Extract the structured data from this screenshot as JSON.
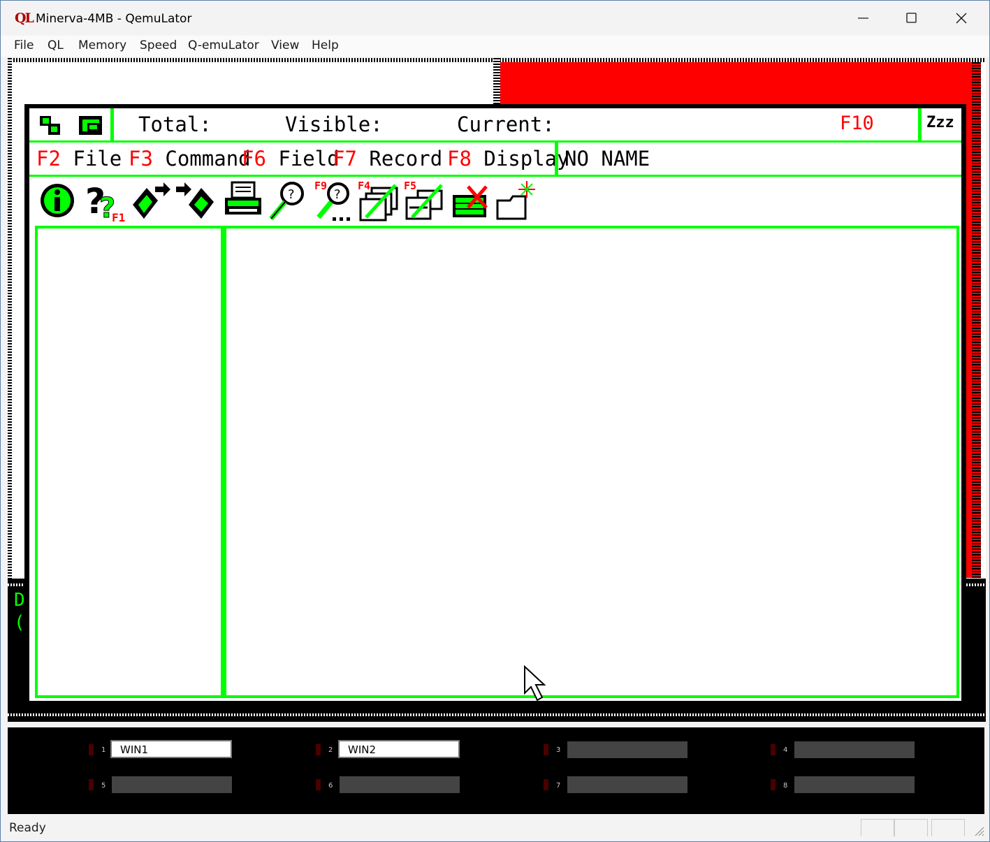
{
  "window": {
    "app_icon": "QL",
    "title": "Minerva-4MB - QemuLator",
    "controls": [
      "minimize-icon",
      "maximize-icon",
      "close-icon"
    ]
  },
  "menu": [
    "File",
    "QL",
    "Memory",
    "Speed",
    "Q-emuLator",
    "View",
    "Help"
  ],
  "ql_app": {
    "header": {
      "total_label": "Total:",
      "visible_label": "Visible:",
      "current_label": "Current:",
      "f10": "F10",
      "sleep_icon": "Zzz"
    },
    "commands": [
      {
        "key": "F2",
        "label": "File"
      },
      {
        "key": "F3",
        "label": "Command"
      },
      {
        "key": "F6",
        "label": "Field"
      },
      {
        "key": "F7",
        "label": "Record"
      },
      {
        "key": "F8",
        "label": "Display"
      }
    ],
    "filename": "NO NAME",
    "toolbar_icons": [
      {
        "name": "info-icon"
      },
      {
        "name": "help-icon",
        "key": "F1"
      },
      {
        "name": "export-icon"
      },
      {
        "name": "import-icon"
      },
      {
        "name": "printer-icon"
      },
      {
        "name": "search-icon"
      },
      {
        "name": "search-next-icon",
        "key": "F9"
      },
      {
        "name": "edit-records-icon",
        "key": "F4"
      },
      {
        "name": "edit-fields-icon",
        "key": "F5"
      },
      {
        "name": "delete-keyboard-icon"
      },
      {
        "name": "new-folder-icon"
      }
    ]
  },
  "slots": [
    {
      "num": "1",
      "label": "WIN1",
      "active": true
    },
    {
      "num": "2",
      "label": "WIN2",
      "active": true
    },
    {
      "num": "3",
      "label": "",
      "active": false
    },
    {
      "num": "4",
      "label": "",
      "active": false
    },
    {
      "num": "5",
      "label": "",
      "active": false
    },
    {
      "num": "6",
      "label": "",
      "active": false
    },
    {
      "num": "7",
      "label": "",
      "active": false
    },
    {
      "num": "8",
      "label": "",
      "active": false
    }
  ],
  "side_text": [
    "D",
    "("
  ],
  "colors": {
    "green": "#00ff00",
    "red": "#ff0000",
    "brand": "#b00000"
  },
  "status": "Ready"
}
